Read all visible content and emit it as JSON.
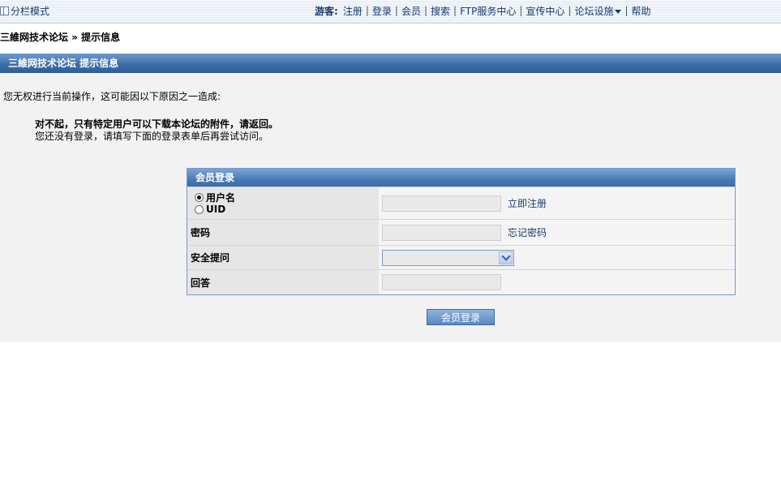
{
  "topbar": {
    "split_mode": "分栏模式",
    "guest_label": "游客:",
    "nav": [
      "注册",
      "登录",
      "会员",
      "搜索",
      "FTP服务中心",
      "宣传中心",
      "论坛设施",
      "帮助"
    ]
  },
  "breadcrumb": "三維网技术论坛 » 提示信息",
  "panel": {
    "header": "三維网技术论坛 提示信息",
    "reason_intro": "您无权进行当前操作，这可能因以下原因之一造成:",
    "message_bold": "对不起，只有特定用户可以下载本论坛的附件，请返回。",
    "message_note": "您还没有登录，请填写下面的登录表单后再尝试访问。"
  },
  "login": {
    "title": "会员登录",
    "radio_username": "用户名",
    "radio_uid": "UID",
    "register_link": "立即注册",
    "password_label": "密码",
    "forgot_link": "忘记密码",
    "question_label": "安全提问",
    "answer_label": "回答",
    "submit_label": "会员登录"
  },
  "colors": {
    "header_blue": "#3f6fa8",
    "link": "#1a3a6b",
    "panel_bg": "#f2f2f2"
  }
}
